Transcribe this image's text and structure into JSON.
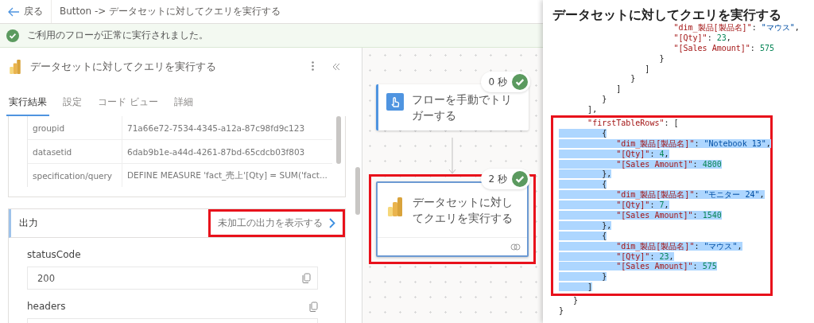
{
  "header": {
    "back_label": "戻る",
    "breadcrumb": "Button -> データセットに対してクエリを実行する"
  },
  "banner": {
    "message": "ご利用のフローが正常に実行されました。"
  },
  "details_panel": {
    "title": "データセットに対してクエリを実行する",
    "tabs": [
      {
        "label": "実行結果",
        "selected": true
      },
      {
        "label": "設定",
        "selected": false
      },
      {
        "label": "コード ビュー",
        "selected": false
      },
      {
        "label": "詳細",
        "selected": false
      }
    ],
    "inputs": [
      {
        "name": "groupid",
        "value": "71a66e72-7534-4345-a12a-87c98fd9c123"
      },
      {
        "name": "datasetid",
        "value": "6dab9b1e-a44d-4261-87bd-65cdcb03f803"
      },
      {
        "name": "specification/query",
        "value": "DEFINE MEASURE 'fact_売上'[Qty] = SUM('fact..."
      }
    ],
    "output": {
      "title": "出力",
      "raw_link": "未加工の出力を表示する",
      "highlighted": true,
      "fields": [
        {
          "name": "statusCode",
          "value": "200"
        },
        {
          "name": "headers"
        }
      ]
    }
  },
  "flow": {
    "nodes": [
      {
        "kind": "trigger",
        "title": "フローを手動でトリガーする",
        "duration": "0 秒",
        "selected": false,
        "highlighted": false
      },
      {
        "kind": "powerbi",
        "title": "データセットに対してクエリを実行する",
        "duration": "2 秒",
        "selected": true,
        "highlighted": true
      }
    ]
  },
  "code_panel": {
    "title": "データセットに対してクエリを実行する",
    "blocks": [
      {
        "boxed": false,
        "lines": [
          {
            "selected": false,
            "tokens": [
              {
                "kind": "key",
                "text": "                        \"dim_製品[製品名]\""
              },
              {
                "kind": "punct",
                "text": ": "
              },
              {
                "kind": "string",
                "text": "\"マウス\""
              },
              {
                "kind": "punct",
                "text": ","
              }
            ]
          },
          {
            "selected": false,
            "tokens": [
              {
                "kind": "key",
                "text": "                        \"[Qty]\""
              },
              {
                "kind": "punct",
                "text": ": "
              },
              {
                "kind": "number",
                "text": "23"
              },
              {
                "kind": "punct",
                "text": ","
              }
            ]
          },
          {
            "selected": false,
            "tokens": [
              {
                "kind": "key",
                "text": "                        \"[Sales Amount]\""
              },
              {
                "kind": "punct",
                "text": ": "
              },
              {
                "kind": "number",
                "text": "575"
              }
            ]
          },
          {
            "selected": false,
            "tokens": [
              {
                "kind": "punct",
                "text": "                     }"
              }
            ]
          },
          {
            "selected": false,
            "tokens": [
              {
                "kind": "punct",
                "text": "                  ]"
              }
            ]
          },
          {
            "selected": false,
            "tokens": [
              {
                "kind": "punct",
                "text": "               }"
              }
            ]
          },
          {
            "selected": false,
            "tokens": [
              {
                "kind": "punct",
                "text": "            ]"
              }
            ]
          },
          {
            "selected": false,
            "tokens": [
              {
                "kind": "punct",
                "text": "         }"
              }
            ]
          },
          {
            "selected": false,
            "tokens": [
              {
                "kind": "punct",
                "text": "      ],"
              }
            ]
          }
        ]
      },
      {
        "boxed": true,
        "lines": [
          {
            "selected": false,
            "tokens": [
              {
                "kind": "key",
                "text": "      \"firstTableRows\""
              },
              {
                "kind": "punct",
                "text": ": ["
              }
            ]
          },
          {
            "selected": true,
            "tokens": [
              {
                "kind": "punct",
                "text": "         {"
              }
            ]
          },
          {
            "selected": true,
            "tokens": [
              {
                "kind": "key",
                "text": "            \"dim_製品[製品名]\""
              },
              {
                "kind": "punct",
                "text": ": "
              },
              {
                "kind": "string",
                "text": "\"Notebook 13\""
              },
              {
                "kind": "punct",
                "text": ","
              }
            ]
          },
          {
            "selected": true,
            "tokens": [
              {
                "kind": "key",
                "text": "            \"[Qty]\""
              },
              {
                "kind": "punct",
                "text": ": "
              },
              {
                "kind": "number",
                "text": "4"
              },
              {
                "kind": "punct",
                "text": ","
              }
            ]
          },
          {
            "selected": true,
            "tokens": [
              {
                "kind": "key",
                "text": "            \"[Sales Amount]\""
              },
              {
                "kind": "punct",
                "text": ": "
              },
              {
                "kind": "number",
                "text": "4800"
              }
            ]
          },
          {
            "selected": true,
            "tokens": [
              {
                "kind": "punct",
                "text": "         },"
              }
            ]
          },
          {
            "selected": true,
            "tokens": [
              {
                "kind": "punct",
                "text": "         {"
              }
            ]
          },
          {
            "selected": true,
            "tokens": [
              {
                "kind": "key",
                "text": "            \"dim_製品[製品名]\""
              },
              {
                "kind": "punct",
                "text": ": "
              },
              {
                "kind": "string",
                "text": "\"モニター 24\""
              },
              {
                "kind": "punct",
                "text": ","
              }
            ]
          },
          {
            "selected": true,
            "tokens": [
              {
                "kind": "key",
                "text": "            \"[Qty]\""
              },
              {
                "kind": "punct",
                "text": ": "
              },
              {
                "kind": "number",
                "text": "7"
              },
              {
                "kind": "punct",
                "text": ","
              }
            ]
          },
          {
            "selected": true,
            "tokens": [
              {
                "kind": "key",
                "text": "            \"[Sales Amount]\""
              },
              {
                "kind": "punct",
                "text": ": "
              },
              {
                "kind": "number",
                "text": "1540"
              }
            ]
          },
          {
            "selected": true,
            "tokens": [
              {
                "kind": "punct",
                "text": "         },"
              }
            ]
          },
          {
            "selected": true,
            "tokens": [
              {
                "kind": "punct",
                "text": "         {"
              }
            ]
          },
          {
            "selected": true,
            "tokens": [
              {
                "kind": "key",
                "text": "            \"dim_製品[製品名]\""
              },
              {
                "kind": "punct",
                "text": ": "
              },
              {
                "kind": "string",
                "text": "\"マウス\""
              },
              {
                "kind": "punct",
                "text": ","
              }
            ]
          },
          {
            "selected": true,
            "tokens": [
              {
                "kind": "key",
                "text": "            \"[Qty]\""
              },
              {
                "kind": "punct",
                "text": ": "
              },
              {
                "kind": "number",
                "text": "23"
              },
              {
                "kind": "punct",
                "text": ","
              }
            ]
          },
          {
            "selected": true,
            "tokens": [
              {
                "kind": "key",
                "text": "            \"[Sales Amount]\""
              },
              {
                "kind": "punct",
                "text": ": "
              },
              {
                "kind": "number",
                "text": "575"
              }
            ]
          },
          {
            "selected": true,
            "tokens": [
              {
                "kind": "punct",
                "text": "         }"
              }
            ]
          },
          {
            "selected": true,
            "tokens": [
              {
                "kind": "punct",
                "text": "      ]"
              }
            ]
          }
        ]
      },
      {
        "boxed": false,
        "lines": [
          {
            "selected": false,
            "tokens": [
              {
                "kind": "punct",
                "text": "   }"
              }
            ]
          },
          {
            "selected": false,
            "tokens": [
              {
                "kind": "punct",
                "text": "}"
              }
            ]
          }
        ]
      }
    ]
  }
}
